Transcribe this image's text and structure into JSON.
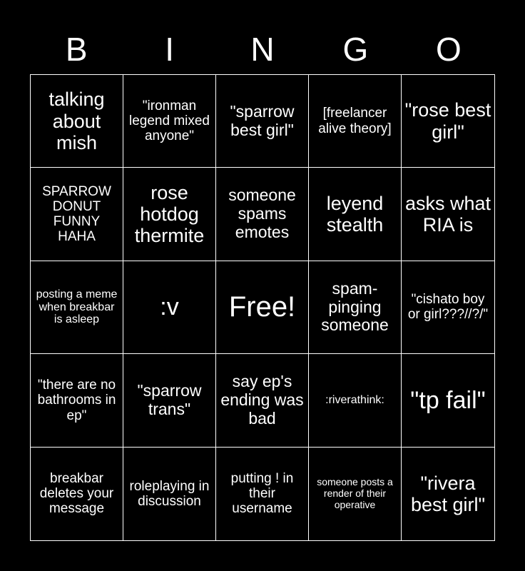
{
  "card": {
    "header_letters": [
      "B",
      "I",
      "N",
      "G",
      "O"
    ],
    "rows": [
      [
        {
          "text": "talking about mish",
          "size": "fs-xl"
        },
        {
          "text": "\"ironman legend mixed anyone\"",
          "size": "fs-md"
        },
        {
          "text": "\"sparrow best girl\"",
          "size": "fs-lg"
        },
        {
          "text": "[freelancer alive theory]",
          "size": "fs-md"
        },
        {
          "text": "\"rose best girl\"",
          "size": "fs-xl"
        }
      ],
      [
        {
          "text": "SPARROW DONUT FUNNY HAHA",
          "size": "fs-md"
        },
        {
          "text": "rose hotdog thermite",
          "size": "fs-xl"
        },
        {
          "text": "someone spams emotes",
          "size": "fs-lg"
        },
        {
          "text": "leyend stealth",
          "size": "fs-xl"
        },
        {
          "text": "asks what RIA is",
          "size": "fs-xl"
        }
      ],
      [
        {
          "text": "posting a meme when breakbar is asleep",
          "size": "fs-sm"
        },
        {
          "text": ":v",
          "size": "fs-2xl"
        },
        {
          "text": "Free!",
          "size": "fs-3xl"
        },
        {
          "text": "spam-pinging someone",
          "size": "fs-lg"
        },
        {
          "text": "\"cishato boy or girl???//?/\"",
          "size": "fs-md"
        }
      ],
      [
        {
          "text": "\"there are no bathrooms in ep\"",
          "size": "fs-md"
        },
        {
          "text": "\"sparrow trans\"",
          "size": "fs-lg"
        },
        {
          "text": "say ep's ending was bad",
          "size": "fs-lg"
        },
        {
          "text": ":riverathink:",
          "size": "fs-sm"
        },
        {
          "text": "\"tp fail\"",
          "size": "fs-2xl"
        }
      ],
      [
        {
          "text": "breakbar deletes your message",
          "size": "fs-md"
        },
        {
          "text": "roleplaying in discussion",
          "size": "fs-md"
        },
        {
          "text": "putting ! in their username",
          "size": "fs-md"
        },
        {
          "text": "someone posts a render of their operative",
          "size": "fs-xs"
        },
        {
          "text": "\"rivera best girl\"",
          "size": "fs-xl"
        }
      ]
    ]
  },
  "colors": {
    "background": "#000000",
    "foreground": "#ffffff",
    "grid_line": "#ffffff"
  }
}
